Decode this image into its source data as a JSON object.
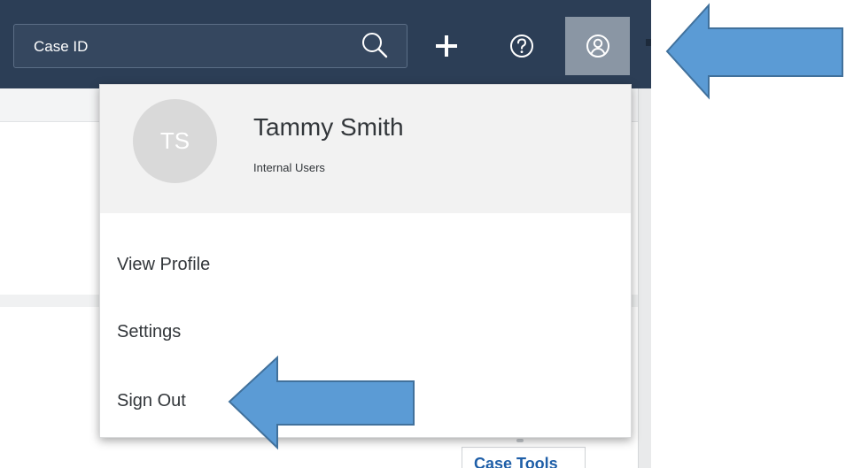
{
  "header": {
    "search_placeholder": "Case ID",
    "icons": {
      "search": "search-icon",
      "create": "plus-icon",
      "help": "help-icon",
      "user": "user-icon"
    }
  },
  "user_menu": {
    "initials": "TS",
    "name": "Tammy Smith",
    "group": "Internal Users",
    "items": [
      {
        "label": "View Profile"
      },
      {
        "label": "Settings"
      },
      {
        "label": "Sign Out"
      }
    ]
  },
  "footer": {
    "case_tools_label": "Case Tools"
  },
  "colors": {
    "header_bg": "#2c3e56",
    "active_button": "#8a96a4",
    "annotation_arrow": "#5b9bd5",
    "annotation_arrow_border": "#41719c",
    "link_blue": "#1f5fa8"
  }
}
